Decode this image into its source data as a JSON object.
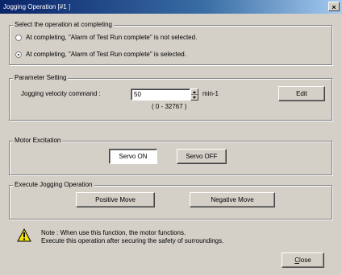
{
  "window": {
    "title": "Jogging Operation [#1",
    "title_suffix": "]",
    "close_label": "×"
  },
  "completion": {
    "legend": "Select the operation at completing",
    "options": [
      {
        "label": "At completing, \"Alarm of Test Run complete\" is not selected.",
        "checked": false
      },
      {
        "label": "At completing, \"Alarm of Test Run complete\" is selected.",
        "checked": true
      }
    ]
  },
  "parameter": {
    "legend": "Parameter Setting",
    "velocity_label": "Jogging velocity command :",
    "velocity_value": "50",
    "unit": "min-1",
    "range": "( 0 - 32767 )",
    "edit_label": "Edit"
  },
  "motor": {
    "legend": "Motor Excitation",
    "servo_on_label": "Servo ON",
    "servo_off_label": "Servo OFF"
  },
  "jog": {
    "legend": "Execute Jogging Operation",
    "positive_label": "Positive Move",
    "negative_label": "Negative Move"
  },
  "note": {
    "line1": "Note : When use this function, the motor functions.",
    "line2": "Execute this operation after securing the safety of surroundings."
  },
  "footer": {
    "close_label_first": "C",
    "close_label_rest": "lose"
  }
}
